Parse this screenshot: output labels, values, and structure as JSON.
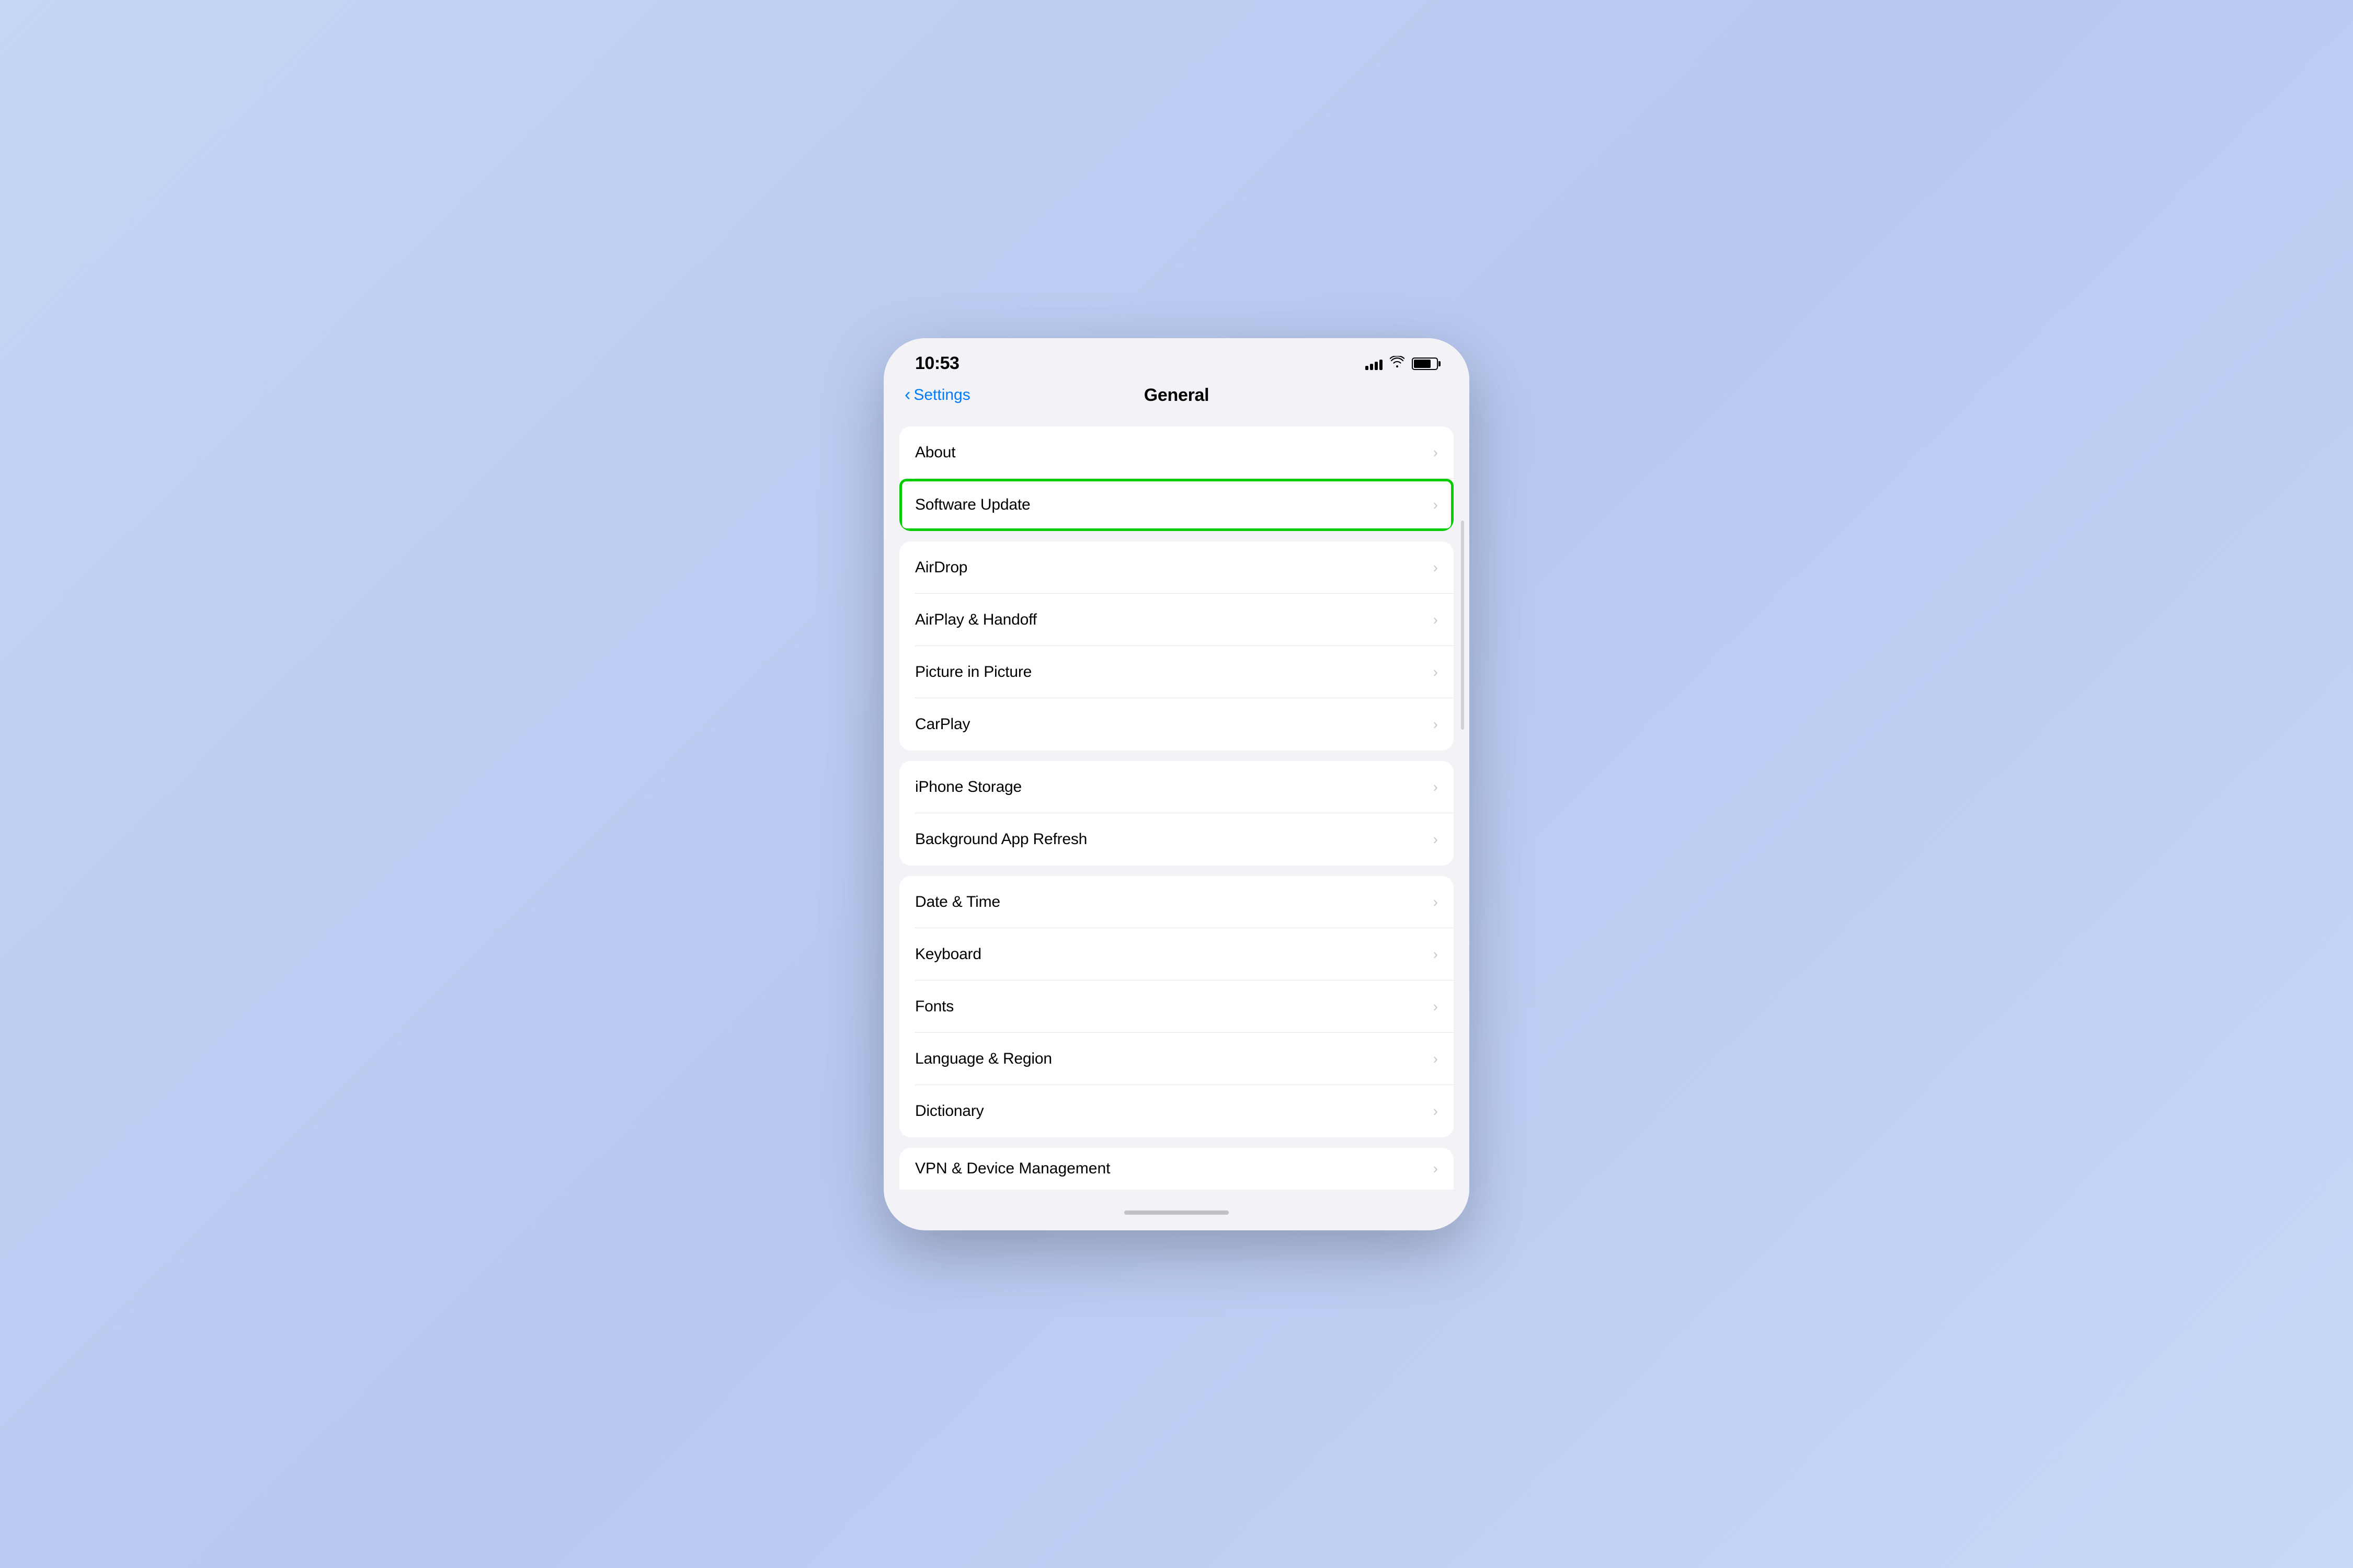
{
  "statusBar": {
    "time": "10:53",
    "batteryLevel": 75
  },
  "navBar": {
    "backLabel": "Settings",
    "title": "General"
  },
  "sections": [
    {
      "id": "section1",
      "items": [
        {
          "id": "about",
          "label": "About",
          "highlighted": false
        },
        {
          "id": "software-update",
          "label": "Software Update",
          "highlighted": true
        }
      ]
    },
    {
      "id": "section2",
      "items": [
        {
          "id": "airdrop",
          "label": "AirDrop",
          "highlighted": false
        },
        {
          "id": "airplay-handoff",
          "label": "AirPlay & Handoff",
          "highlighted": false
        },
        {
          "id": "picture-in-picture",
          "label": "Picture in Picture",
          "highlighted": false
        },
        {
          "id": "carplay",
          "label": "CarPlay",
          "highlighted": false
        }
      ]
    },
    {
      "id": "section3",
      "items": [
        {
          "id": "iphone-storage",
          "label": "iPhone Storage",
          "highlighted": false
        },
        {
          "id": "background-app-refresh",
          "label": "Background App Refresh",
          "highlighted": false
        }
      ]
    },
    {
      "id": "section4",
      "items": [
        {
          "id": "date-time",
          "label": "Date & Time",
          "highlighted": false
        },
        {
          "id": "keyboard",
          "label": "Keyboard",
          "highlighted": false
        },
        {
          "id": "fonts",
          "label": "Fonts",
          "highlighted": false
        },
        {
          "id": "language-region",
          "label": "Language & Region",
          "highlighted": false
        },
        {
          "id": "dictionary",
          "label": "Dictionary",
          "highlighted": false
        }
      ]
    }
  ],
  "vpnItem": {
    "label": "VPN & Device Management"
  },
  "chevronChar": "›",
  "backChevronChar": "‹"
}
